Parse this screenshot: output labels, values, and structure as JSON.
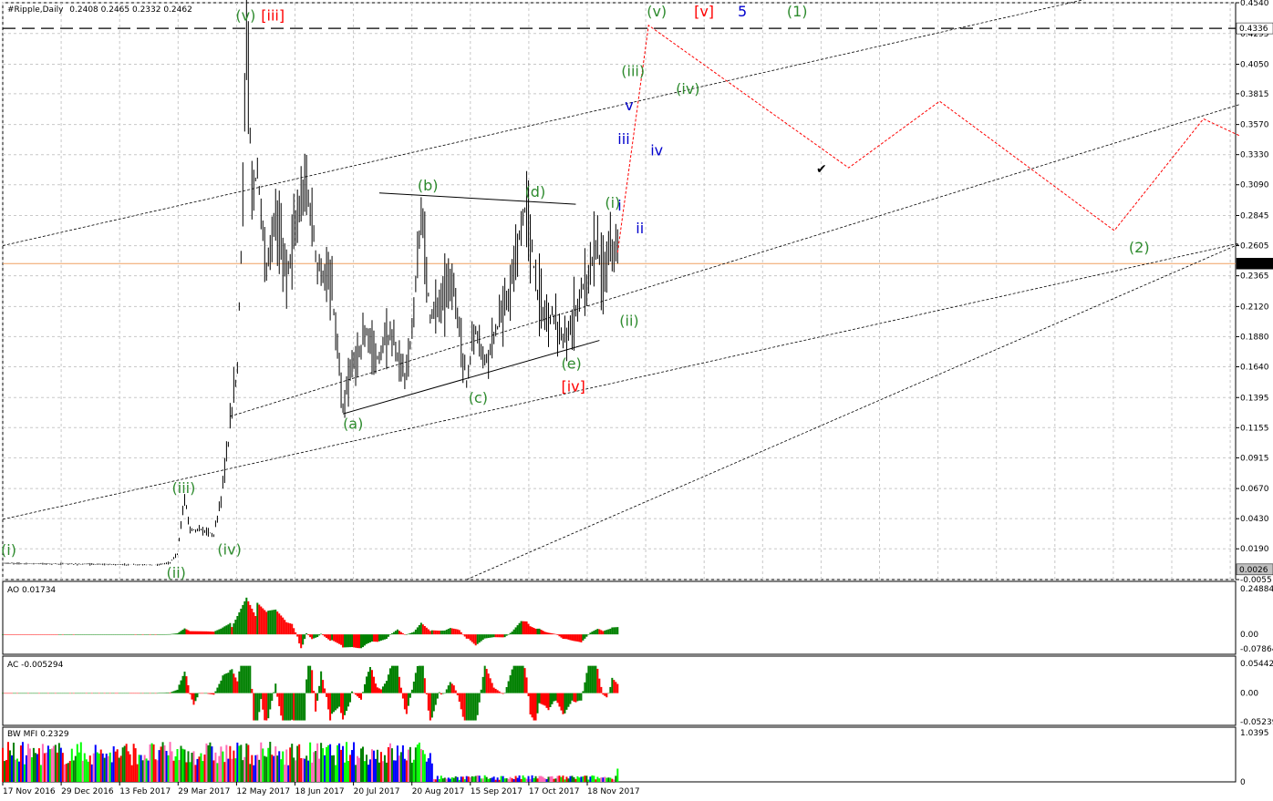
{
  "header": {
    "symbol": "#Ripple,Daily",
    "ohlc": "0.2408 0.2465 0.2332 0.2462"
  },
  "colors": {
    "background": "#ffffff",
    "grid": "#c8c8c8",
    "candle": "#000000",
    "bull": "#008000",
    "bear": "#ff0000",
    "wave_green": "#2e8b2e",
    "wave_red": "#ff0000",
    "wave_blue": "#0000cc",
    "price_line": "#f0a060",
    "forecast": "#ff0000",
    "mfi_colors": [
      "#008000",
      "#0000ff",
      "#ff0000",
      "#ff69b4",
      "#00ff00"
    ]
  },
  "price_axis": {
    "min": -0.0055,
    "max": 0.454,
    "ticks": [
      "0.4540",
      "0.4295",
      "0.4050",
      "0.3815",
      "0.3570",
      "0.3330",
      "0.3090",
      "0.2845",
      "0.2605",
      "0.2365",
      "0.2120",
      "0.1880",
      "0.1640",
      "0.1395",
      "0.1155",
      "0.0915",
      "0.0670",
      "0.0430",
      "0.0190",
      "-0.0055"
    ],
    "marker_top": "0.4336",
    "marker_current": "0.2462",
    "marker_current_value": 0.2462,
    "marker_bottom": "0.0026"
  },
  "time_axis": {
    "ticks": [
      "17 Nov 2016",
      "29 Dec 2016",
      "13 Feb 2017",
      "29 Mar 2017",
      "12 May 2017",
      "18 Jun 2017",
      "20 Jul 2017",
      "20 Aug 2017",
      "15 Sep 2017",
      "17 Oct 2017",
      "18 Nov 2017"
    ]
  },
  "wave_labels": [
    {
      "text": "(i)",
      "color": "green",
      "i": -1,
      "v": 0.014
    },
    {
      "text": "(ii)",
      "color": "green",
      "i": 90,
      "v": -0.004
    },
    {
      "text": "(iii)",
      "color": "green",
      "i": 93,
      "v": 0.0635
    },
    {
      "text": "(iv)",
      "color": "green",
      "i": 118,
      "v": 0.0145
    },
    {
      "text": "(v)",
      "color": "green",
      "i": 128,
      "v": 0.44
    },
    {
      "text": "[iii]",
      "color": "red",
      "i": 142,
      "v": 0.44
    },
    {
      "text": "(a)",
      "color": "green",
      "i": 187,
      "v": 0.1145
    },
    {
      "text": "(b)",
      "color": "green",
      "i": 228,
      "v": 0.3045
    },
    {
      "text": "(c)",
      "color": "green",
      "i": 256,
      "v": 0.1355
    },
    {
      "text": "(d)",
      "color": "green",
      "i": 287,
      "v": 0.2995
    },
    {
      "text": "(e)",
      "color": "green",
      "i": 307,
      "v": 0.1625
    },
    {
      "text": "[iv]",
      "color": "red",
      "i": 307,
      "v": 0.1445
    },
    {
      "text": "(i)",
      "color": "green",
      "i": 331,
      "v": 0.2905
    },
    {
      "text": "i",
      "color": "blue",
      "i": 338,
      "v": 0.2885
    },
    {
      "text": "ii",
      "color": "blue",
      "i": 348,
      "v": 0.2705
    },
    {
      "text": "(ii)",
      "color": "green",
      "i": 339,
      "v": 0.1965
    },
    {
      "text": "(iii)",
      "color": "green",
      "i": 340,
      "v": 0.3955
    },
    {
      "text": "v",
      "color": "blue",
      "i": 342,
      "v": 0.3685
    },
    {
      "text": "iii",
      "color": "blue",
      "i": 338,
      "v": 0.3415
    },
    {
      "text": "iv",
      "color": "blue",
      "i": 356,
      "v": 0.3325
    },
    {
      "text": "(iv)",
      "color": "green",
      "i": 370,
      "v": 0.3815
    },
    {
      "text": "(v)",
      "color": "green",
      "i": 354,
      "v": 0.443
    },
    {
      "text": "[v]",
      "color": "red",
      "i": 380,
      "v": 0.443
    },
    {
      "text": "5",
      "color": "blue",
      "i": 404,
      "v": 0.443
    },
    {
      "text": "(1)",
      "color": "green",
      "i": 431,
      "v": 0.443
    },
    {
      "text": "(2)",
      "color": "green",
      "i": 619,
      "v": 0.255
    }
  ],
  "chart_data": {
    "type": "bar",
    "subtype": "ohlc-price-chart-with-elliott-wave-forecast",
    "symbol": "#Ripple,Daily",
    "last_close": 0.2462,
    "ylim": [
      -0.0055,
      0.454
    ],
    "grid": true,
    "price_series": {
      "name": "#Ripple,Daily",
      "start_date": "2016-11-17",
      "points": [
        [
          0,
          0.0075
        ],
        [
          40,
          0.0068
        ],
        [
          85,
          0.0062
        ],
        [
          92,
          0.008
        ],
        [
          96,
          0.015
        ],
        [
          100,
          0.06
        ],
        [
          103,
          0.035
        ],
        [
          112,
          0.033
        ],
        [
          116,
          0.03
        ],
        [
          120,
          0.06
        ],
        [
          124,
          0.102
        ],
        [
          126,
          0.13
        ],
        [
          129,
          0.165
        ],
        [
          132,
          0.3
        ],
        [
          134,
          0.436
        ],
        [
          137,
          0.3
        ],
        [
          140,
          0.32
        ],
        [
          145,
          0.235
        ],
        [
          150,
          0.285
        ],
        [
          156,
          0.24
        ],
        [
          162,
          0.28
        ],
        [
          167,
          0.31
        ],
        [
          173,
          0.245
        ],
        [
          181,
          0.225
        ],
        [
          187,
          0.128
        ],
        [
          192,
          0.165
        ],
        [
          200,
          0.19
        ],
        [
          206,
          0.17
        ],
        [
          213,
          0.19
        ],
        [
          221,
          0.155
        ],
        [
          226,
          0.2
        ],
        [
          230,
          0.295
        ],
        [
          235,
          0.205
        ],
        [
          240,
          0.215
        ],
        [
          246,
          0.235
        ],
        [
          250,
          0.205
        ],
        [
          255,
          0.152
        ],
        [
          260,
          0.195
        ],
        [
          265,
          0.168
        ],
        [
          270,
          0.19
        ],
        [
          275,
          0.205
        ],
        [
          280,
          0.23
        ],
        [
          284,
          0.265
        ],
        [
          288,
          0.295
        ],
        [
          293,
          0.23
        ],
        [
          298,
          0.205
        ],
        [
          304,
          0.205
        ],
        [
          308,
          0.18
        ],
        [
          312,
          0.195
        ],
        [
          316,
          0.215
        ],
        [
          320,
          0.23
        ],
        [
          324,
          0.25
        ],
        [
          327,
          0.26
        ],
        [
          330,
          0.235
        ],
        [
          335,
          0.262
        ],
        [
          338,
          0.2462
        ]
      ]
    },
    "forecast_path": [
      [
        338,
        0.255
      ],
      [
        355,
        0.436
      ],
      [
        465,
        0.3225
      ],
      [
        515,
        0.3755
      ],
      [
        611,
        0.2725
      ],
      [
        660,
        0.3615
      ],
      [
        680,
        0.348
      ]
    ],
    "levels": {
      "dashed_high": 0.4336,
      "current": 0.2462
    },
    "channel_lines": [
      {
        "p1": [
          0,
          0.2605
        ],
        "p2": [
          640,
          0.4715
        ]
      },
      {
        "p1": [
          0,
          0.0425
        ],
        "p2": [
          680,
          0.2625
        ]
      },
      {
        "p1": [
          125,
          0.1245
        ],
        "p2": [
          680,
          0.373
        ]
      },
      {
        "p1": [
          255,
          -0.0055
        ],
        "p2": [
          680,
          0.262
        ]
      }
    ],
    "triangle": {
      "upper": [
        [
          207,
          0.3025
        ],
        [
          315,
          0.2935
        ]
      ],
      "lower": [
        [
          187,
          0.1265
        ],
        [
          328,
          0.185
        ]
      ]
    },
    "indicators": [
      {
        "name": "AO",
        "value_label": "AO 0.01734",
        "ticks": [
          "0.24884",
          "0.00",
          "-0.07864"
        ],
        "ylim": [
          -0.07864,
          0.24884
        ]
      },
      {
        "name": "AC",
        "value_label": "AC -0.005294",
        "ticks": [
          "0.054421",
          "0.00",
          "-0.05239"
        ],
        "ylim": [
          -0.05239,
          0.054421
        ]
      },
      {
        "name": "BW MFI",
        "value_label": "BW MFI 0.2329",
        "ticks": [
          "1.0395",
          "0"
        ],
        "ylim": [
          0,
          1.0395
        ]
      }
    ]
  }
}
